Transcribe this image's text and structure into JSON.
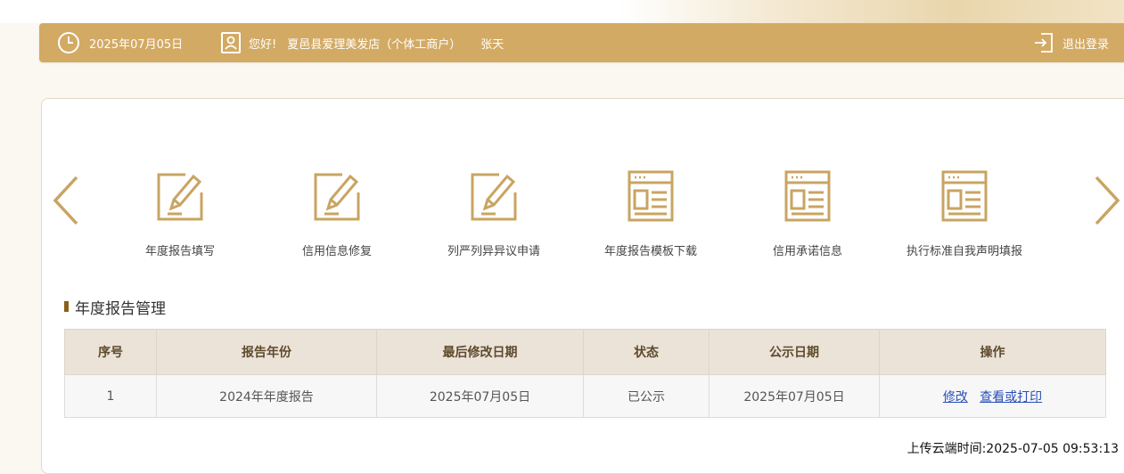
{
  "header": {
    "date": "2025年07月05日",
    "greeting": "您好!",
    "shop_name": "夏邑县爱理美发店（个体工商户）",
    "user_name": "张天",
    "logout_label": "退出登录",
    "accent_color": "#d3aa64"
  },
  "services": [
    {
      "label": "年度报告填写",
      "icon": "edit-document-icon"
    },
    {
      "label": "信用信息修复",
      "icon": "edit-document-icon"
    },
    {
      "label": "列严列异异议申请",
      "icon": "edit-document-icon"
    },
    {
      "label": "年度报告模板下载",
      "icon": "webpage-template-icon"
    },
    {
      "label": "信用承诺信息",
      "icon": "webpage-template-icon"
    },
    {
      "label": "执行标准自我声明填报",
      "icon": "webpage-template-icon"
    }
  ],
  "section": {
    "title": "年度报告管理"
  },
  "table": {
    "headers": [
      "序号",
      "报告年份",
      "最后修改日期",
      "状态",
      "公示日期",
      "操作"
    ],
    "rows": [
      {
        "index": "1",
        "year": "2024年年度报告",
        "modified": "2025年07月05日",
        "status": "已公示",
        "published": "2025年07月05日",
        "action_edit": "修改",
        "action_view": "查看或打印"
      }
    ]
  },
  "footer": {
    "upload_time": "上传云端时间:2025-07-05 09:53:13"
  }
}
